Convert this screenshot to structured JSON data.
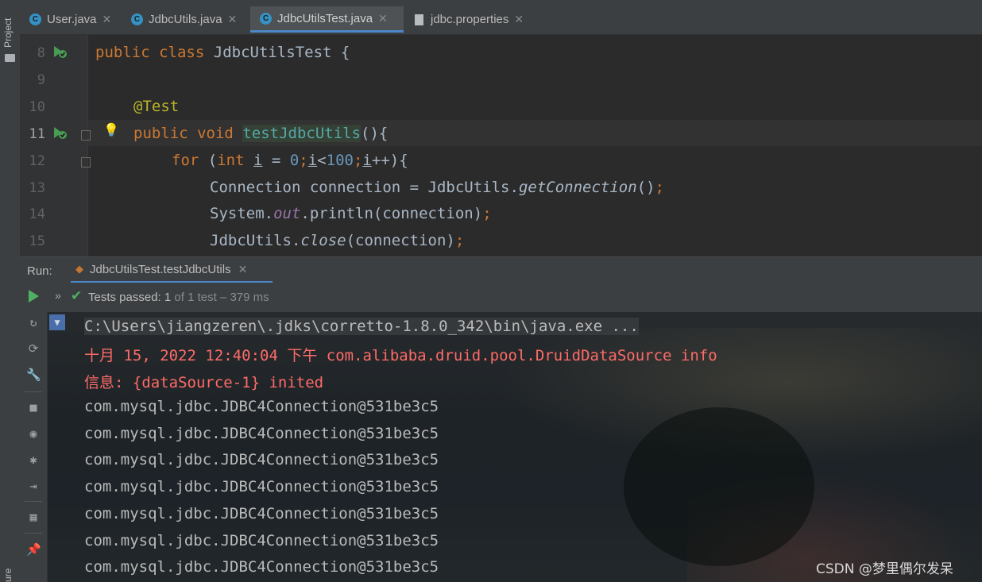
{
  "sidebar": {
    "project_label": "Project",
    "structure_label": "ure"
  },
  "tabs": [
    {
      "label": "User.java",
      "icon": "C"
    },
    {
      "label": "JdbcUtils.java",
      "icon": "C"
    },
    {
      "label": "JdbcUtilsTest.java",
      "icon": "C"
    },
    {
      "label": "jdbc.properties",
      "icon": "file"
    }
  ],
  "editor": {
    "line_numbers": [
      "8",
      "9",
      "10",
      "11",
      "12",
      "13",
      "14",
      "15"
    ],
    "lines": {
      "l8": [
        "public",
        "class",
        "JdbcUtilsTest {"
      ],
      "l10": [
        "@Test"
      ],
      "l11": [
        "public",
        "void",
        "testJdbcUtils",
        "(){"
      ],
      "l12": [
        "for",
        "(",
        "int",
        "i",
        "=",
        "0",
        ";",
        "i",
        "<",
        "100",
        ";",
        "i",
        "++){"
      ],
      "l13": [
        "Connection connection = JdbcUtils.",
        "getConnection",
        "()",
        ";"
      ],
      "l14": [
        "System.",
        "out",
        ".println(connection)",
        ";"
      ],
      "l15": [
        "JdbcUtils.",
        "close",
        "(connection)",
        ";"
      ]
    }
  },
  "run": {
    "label": "Run:",
    "tab_label": "JdbcUtilsTest.testJdbcUtils",
    "status_main": "Tests passed: 1",
    "status_detail": "of 1 test – 379 ms"
  },
  "console": {
    "lines": [
      {
        "text": "C:\\Users\\jiangzeren\\.jdks\\corretto-1.8.0_342\\bin\\java.exe ...",
        "style": "cmd"
      },
      {
        "text": "十月 15, 2022 12:40:04 下午 com.alibaba.druid.pool.DruidDataSource info",
        "style": "err"
      },
      {
        "text": "信息: {dataSource-1} inited",
        "style": "err"
      },
      {
        "text": "com.mysql.jdbc.JDBC4Connection@531be3c5",
        "style": "out"
      },
      {
        "text": "com.mysql.jdbc.JDBC4Connection@531be3c5",
        "style": "out"
      },
      {
        "text": "com.mysql.jdbc.JDBC4Connection@531be3c5",
        "style": "out"
      },
      {
        "text": "com.mysql.jdbc.JDBC4Connection@531be3c5",
        "style": "out"
      },
      {
        "text": "com.mysql.jdbc.JDBC4Connection@531be3c5",
        "style": "out"
      },
      {
        "text": "com.mysql.jdbc.JDBC4Connection@531be3c5",
        "style": "out"
      },
      {
        "text": "com.mysql.jdbc.JDBC4Connection@531be3c5",
        "style": "out"
      }
    ]
  },
  "watermark": "CSDN @梦里偶尔发呆",
  "colors": {
    "keyword": "#cc7832",
    "annotation": "#bbb529",
    "method": "#ffc66d",
    "number": "#6897bb",
    "field": "#9876aa",
    "error": "#ff6b68",
    "accent": "#4a88c7",
    "pass": "#4fb064"
  },
  "icons": {
    "run_gutter": "run-test-icon",
    "bulb": "lightbulb-icon",
    "play": "play-icon",
    "check": "check-icon"
  }
}
